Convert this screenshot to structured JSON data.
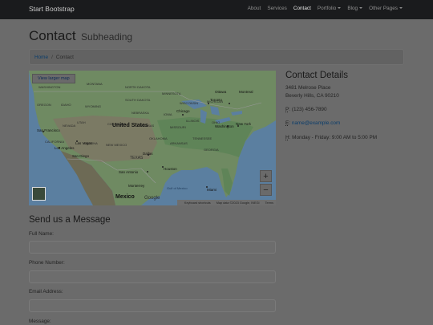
{
  "navbar": {
    "brand": "Start Bootstrap",
    "items": [
      {
        "label": "About"
      },
      {
        "label": "Services"
      },
      {
        "label": "Contact"
      },
      {
        "label": "Portfolio"
      },
      {
        "label": "Blog"
      },
      {
        "label": "Other Pages"
      }
    ]
  },
  "page": {
    "title": "Contact",
    "subtitle": "Subheading"
  },
  "breadcrumb": {
    "home": "Home",
    "separator": "/",
    "current": "Contact"
  },
  "map": {
    "larger_map": "View larger map",
    "zoom_in": "+",
    "zoom_out": "−",
    "google": "Google",
    "attribution": {
      "shortcuts": "Keyboard shortcuts",
      "data": "Map data ©2023 Google, INEGI",
      "terms": "Terms"
    },
    "labels": {
      "united_states": "United States",
      "mexico": "Mexico",
      "san_francisco": "San Francisco",
      "los_angeles": "Los Angeles",
      "las_vegas": "Las Vegas",
      "san_diego": "San Diego",
      "chicago": "Chicago",
      "toronto": "Toronto",
      "ottawa": "Ottawa",
      "montreal": "Montreal",
      "new_york": "New York",
      "washington": "Washington",
      "dallas": "Dallas",
      "houston": "Houston",
      "san_antonio": "San Antonio",
      "monterrey": "Monterrey",
      "miami": "Miami",
      "gulf": "Gulf of Mexico",
      "montana": "MONTANA",
      "wyoming": "WYOMING",
      "nevada": "NEVADA",
      "utah": "UTAH",
      "colorado": "COLORADO",
      "arizona": "ARIZONA",
      "new_mexico": "NEW MEXICO",
      "texas": "TEXAS",
      "kansas": "KANSAS",
      "oklahoma": "OKLAHOMA",
      "nebraska": "NEBRASKA",
      "south_dakota": "SOUTH DAKOTA",
      "north_dakota": "NORTH DAKOTA",
      "minnesota": "MINNESOTA",
      "iowa": "IOWA",
      "missouri": "MISSOURI",
      "illinois": "ILLINOIS",
      "wisconsin": "WISCONSIN",
      "michigan": "MICHIGAN",
      "ohio": "OHIO",
      "tennessee": "TENNESSEE",
      "arkansas": "ARKANSAS",
      "georgia": "GEORGIA",
      "oregon": "OREGON",
      "idaho": "IDAHO",
      "california": "CALIFORNIA",
      "washington_state": "WASHINGTON"
    }
  },
  "contact": {
    "heading": "Contact Details",
    "address_line1": "3481 Melrose Place",
    "address_line2": "Beverly Hills, CA 90210",
    "phone_abbr": "P",
    "phone": ": (123) 456-7890",
    "email_abbr": "E",
    "email_sep": ": ",
    "email": "name@example.com",
    "hours_abbr": "H",
    "hours": ": Monday - Friday: 9:00 AM to 5:00 PM"
  },
  "form": {
    "title": "Send us a Message",
    "full_name_label": "Full Name:",
    "phone_label": "Phone Number:",
    "email_label": "Email Address:",
    "message_label": "Message:"
  }
}
